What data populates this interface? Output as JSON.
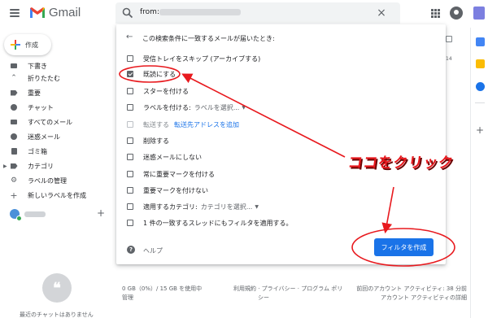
{
  "header": {
    "app_name": "Gmail",
    "search_value": "from:",
    "close_label": "×"
  },
  "compose": {
    "label": "作成"
  },
  "sidebar": {
    "items": [
      {
        "label": "下書き",
        "icon": "draft-icon"
      },
      {
        "label": "折りたたむ",
        "icon": "chevron-up-icon"
      },
      {
        "label": "重要",
        "icon": "important-icon"
      },
      {
        "label": "チャット",
        "icon": "chat-icon"
      },
      {
        "label": "すべてのメール",
        "icon": "mail-icon"
      },
      {
        "label": "迷惑メール",
        "icon": "spam-icon"
      },
      {
        "label": "ゴミ箱",
        "icon": "trash-icon"
      },
      {
        "label": "カテゴリ",
        "icon": "label-icon"
      },
      {
        "label": "ラベルの管理",
        "icon": "gear-icon"
      },
      {
        "label": "新しいラベルを作成",
        "icon": "plus-icon"
      }
    ],
    "hangout_add": "+",
    "empty_chat_text": "最近のチャットはありません"
  },
  "dialog": {
    "heading": "この検索条件に一致するメールが届いたとき:",
    "options": [
      {
        "label": "受信トレイをスキップ (アーカイブする)",
        "checked": false
      },
      {
        "label": "既読にする",
        "checked": true
      },
      {
        "label": "スターを付ける",
        "checked": false
      },
      {
        "label": "ラベルを付ける:",
        "extra": "ラベルを選択...",
        "checked": false
      },
      {
        "label": "転送する",
        "link": "転送先アドレスを追加",
        "checked": false,
        "disabled": true
      },
      {
        "label": "削除する",
        "checked": false
      },
      {
        "label": "迷惑メールにしない",
        "checked": false
      },
      {
        "label": "常に重要マークを付ける",
        "checked": false
      },
      {
        "label": "重要マークを付けない",
        "checked": false
      },
      {
        "label": "適用するカテゴリ:",
        "extra": "カテゴリを選択...",
        "checked": false
      },
      {
        "label": "1 件の一致するスレッドにもフィルタを適用する。",
        "checked": false
      }
    ],
    "help_label": "ヘルプ",
    "create_button": "フィルタを作成"
  },
  "background": {
    "row_date": "14",
    "footer_storage": "0 GB（0%）/ 15 GB を使用中",
    "footer_manage": "管理",
    "footer_terms": "利用規約 · プライバシー",
    "footer_terms2": "シー",
    "footer_policy": "· プログラム ポリ",
    "footer_activity1": "前回のアカウント アクティビティ: 38 分前",
    "footer_activity2": "アカウント アクティビティの詳細"
  },
  "annotation": {
    "callout": "ココをクリック",
    "color": "#e8191e"
  }
}
